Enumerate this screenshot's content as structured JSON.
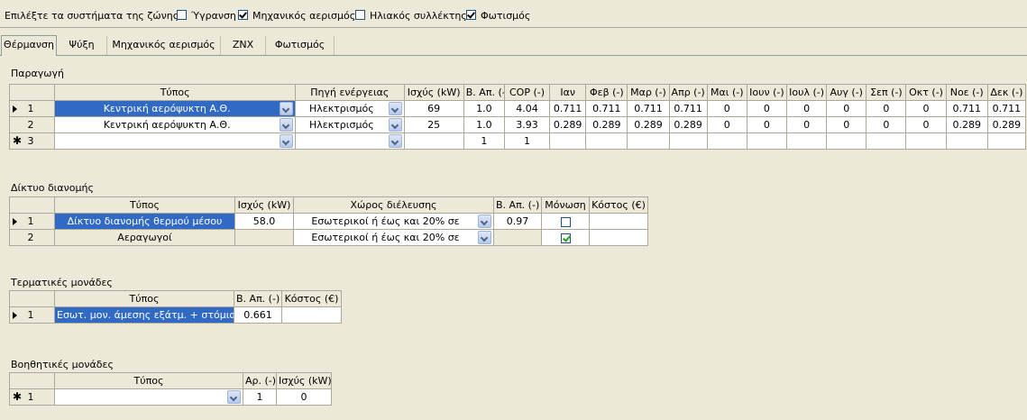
{
  "zone_bar": {
    "label": "Επιλέξτε τα συστήματα της ζώνης:",
    "options": [
      {
        "label": "Ύγρανση",
        "checked": false
      },
      {
        "label": "Μηχανικός αερισμός",
        "checked": true
      },
      {
        "label": "Ηλιακός συλλέκτης",
        "checked": false
      },
      {
        "label": "Φωτισμός",
        "checked": true
      }
    ]
  },
  "tabs": [
    "Θέρμανση",
    "Ψύξη",
    "Μηχανικός αερισμός",
    "ΖΝΧ",
    "Φωτισμός"
  ],
  "active_tab": "Θέρμανση",
  "production": {
    "title": "Παραγωγή",
    "headers": [
      "Τύπος",
      "Πηγή ενέργειας",
      "Ισχύς (kW)",
      "Β. Απ. (-)",
      "COP (-)",
      "Ιαν",
      "Φεβ (-)",
      "Μαρ (-)",
      "Απρ (-)",
      "Μαι (-)",
      "Ιουν (-)",
      "Ιουλ (-)",
      "Αυγ (-)",
      "Σεπ (-)",
      "Οκτ (-)",
      "Νοε (-)",
      "Δεκ (-)"
    ],
    "rows": [
      {
        "num": "1",
        "cells": [
          "Κεντρική αερόψυκτη Α.Θ.",
          "Ηλεκτρισμός",
          "69",
          "1.0",
          "4.04",
          "0.711",
          "0.711",
          "0.711",
          "0.711",
          "0",
          "0",
          "0",
          "0",
          "0",
          "0",
          "0.711",
          "0.711"
        ]
      },
      {
        "num": "2",
        "cells": [
          "Κεντρική αερόψυκτη Α.Θ.",
          "Ηλεκτρισμός",
          "25",
          "1.0",
          "3.93",
          "0.289",
          "0.289",
          "0.289",
          "0.289",
          "0",
          "0",
          "0",
          "0",
          "0",
          "0",
          "0.289",
          "0.289"
        ]
      },
      {
        "num": "3",
        "cells": [
          "",
          "",
          "",
          "1",
          "1",
          "",
          "",
          "",
          "",
          "",
          "",
          "",
          "",
          "",
          "",
          "",
          ""
        ]
      }
    ]
  },
  "distribution": {
    "title": "Δίκτυο διανομής",
    "headers": [
      "Τύπος",
      "Ισχύς (kW)",
      "Χώρος διέλευσης",
      "Β. Απ. (-)",
      "Μόνωση",
      "Κόστος (€)"
    ],
    "rows": [
      {
        "num": "1",
        "type": "Δίκτυο διανομής θερμού μέσου",
        "power": "58.0",
        "space": "Εσωτερικοί ή έως και 20% σε",
        "eff": "0.97",
        "insulation": false,
        "cost": ""
      },
      {
        "num": "2",
        "type": "Αεραγωγοί",
        "power": "",
        "space": "Εσωτερικοί ή έως και 20% σε",
        "eff": "",
        "insulation": true,
        "cost": ""
      }
    ]
  },
  "terminal": {
    "title": "Τερματικές μονάδες",
    "headers": [
      "Τύπος",
      "Β. Απ. (-)",
      "Κόστος (€)"
    ],
    "rows": [
      {
        "num": "1",
        "type": "Εσωτ. μον. άμεσης εξάτμ. + στόμια",
        "eff": "0.661",
        "cost": ""
      }
    ]
  },
  "auxiliary": {
    "title": "Βοηθητικές μονάδες",
    "headers": [
      "Τύπος",
      "Αρ. (-)",
      "Ισχύς (kW)"
    ],
    "rows": [
      {
        "num": "1",
        "type": "",
        "count": "1",
        "power": "0"
      }
    ]
  }
}
